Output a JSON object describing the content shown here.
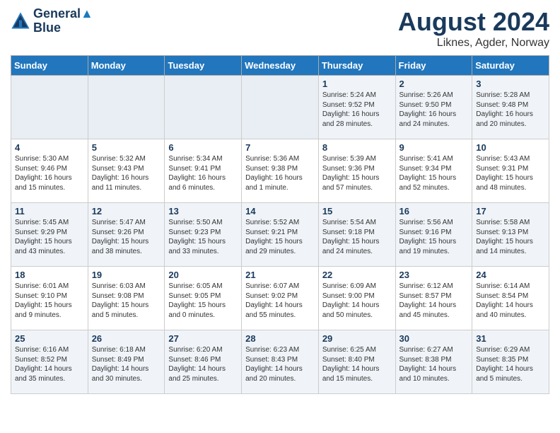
{
  "logo": {
    "line1": "General",
    "line2": "Blue"
  },
  "title": "August 2024",
  "subtitle": "Liknes, Agder, Norway",
  "header_days": [
    "Sunday",
    "Monday",
    "Tuesday",
    "Wednesday",
    "Thursday",
    "Friday",
    "Saturday"
  ],
  "weeks": [
    [
      {
        "day": "",
        "info": ""
      },
      {
        "day": "",
        "info": ""
      },
      {
        "day": "",
        "info": ""
      },
      {
        "day": "",
        "info": ""
      },
      {
        "day": "1",
        "info": "Sunrise: 5:24 AM\nSunset: 9:52 PM\nDaylight: 16 hours\nand 28 minutes."
      },
      {
        "day": "2",
        "info": "Sunrise: 5:26 AM\nSunset: 9:50 PM\nDaylight: 16 hours\nand 24 minutes."
      },
      {
        "day": "3",
        "info": "Sunrise: 5:28 AM\nSunset: 9:48 PM\nDaylight: 16 hours\nand 20 minutes."
      }
    ],
    [
      {
        "day": "4",
        "info": "Sunrise: 5:30 AM\nSunset: 9:46 PM\nDaylight: 16 hours\nand 15 minutes."
      },
      {
        "day": "5",
        "info": "Sunrise: 5:32 AM\nSunset: 9:43 PM\nDaylight: 16 hours\nand 11 minutes."
      },
      {
        "day": "6",
        "info": "Sunrise: 5:34 AM\nSunset: 9:41 PM\nDaylight: 16 hours\nand 6 minutes."
      },
      {
        "day": "7",
        "info": "Sunrise: 5:36 AM\nSunset: 9:38 PM\nDaylight: 16 hours\nand 1 minute."
      },
      {
        "day": "8",
        "info": "Sunrise: 5:39 AM\nSunset: 9:36 PM\nDaylight: 15 hours\nand 57 minutes."
      },
      {
        "day": "9",
        "info": "Sunrise: 5:41 AM\nSunset: 9:34 PM\nDaylight: 15 hours\nand 52 minutes."
      },
      {
        "day": "10",
        "info": "Sunrise: 5:43 AM\nSunset: 9:31 PM\nDaylight: 15 hours\nand 48 minutes."
      }
    ],
    [
      {
        "day": "11",
        "info": "Sunrise: 5:45 AM\nSunset: 9:29 PM\nDaylight: 15 hours\nand 43 minutes."
      },
      {
        "day": "12",
        "info": "Sunrise: 5:47 AM\nSunset: 9:26 PM\nDaylight: 15 hours\nand 38 minutes."
      },
      {
        "day": "13",
        "info": "Sunrise: 5:50 AM\nSunset: 9:23 PM\nDaylight: 15 hours\nand 33 minutes."
      },
      {
        "day": "14",
        "info": "Sunrise: 5:52 AM\nSunset: 9:21 PM\nDaylight: 15 hours\nand 29 minutes."
      },
      {
        "day": "15",
        "info": "Sunrise: 5:54 AM\nSunset: 9:18 PM\nDaylight: 15 hours\nand 24 minutes."
      },
      {
        "day": "16",
        "info": "Sunrise: 5:56 AM\nSunset: 9:16 PM\nDaylight: 15 hours\nand 19 minutes."
      },
      {
        "day": "17",
        "info": "Sunrise: 5:58 AM\nSunset: 9:13 PM\nDaylight: 15 hours\nand 14 minutes."
      }
    ],
    [
      {
        "day": "18",
        "info": "Sunrise: 6:01 AM\nSunset: 9:10 PM\nDaylight: 15 hours\nand 9 minutes."
      },
      {
        "day": "19",
        "info": "Sunrise: 6:03 AM\nSunset: 9:08 PM\nDaylight: 15 hours\nand 5 minutes."
      },
      {
        "day": "20",
        "info": "Sunrise: 6:05 AM\nSunset: 9:05 PM\nDaylight: 15 hours\nand 0 minutes."
      },
      {
        "day": "21",
        "info": "Sunrise: 6:07 AM\nSunset: 9:02 PM\nDaylight: 14 hours\nand 55 minutes."
      },
      {
        "day": "22",
        "info": "Sunrise: 6:09 AM\nSunset: 9:00 PM\nDaylight: 14 hours\nand 50 minutes."
      },
      {
        "day": "23",
        "info": "Sunrise: 6:12 AM\nSunset: 8:57 PM\nDaylight: 14 hours\nand 45 minutes."
      },
      {
        "day": "24",
        "info": "Sunrise: 6:14 AM\nSunset: 8:54 PM\nDaylight: 14 hours\nand 40 minutes."
      }
    ],
    [
      {
        "day": "25",
        "info": "Sunrise: 6:16 AM\nSunset: 8:52 PM\nDaylight: 14 hours\nand 35 minutes."
      },
      {
        "day": "26",
        "info": "Sunrise: 6:18 AM\nSunset: 8:49 PM\nDaylight: 14 hours\nand 30 minutes."
      },
      {
        "day": "27",
        "info": "Sunrise: 6:20 AM\nSunset: 8:46 PM\nDaylight: 14 hours\nand 25 minutes."
      },
      {
        "day": "28",
        "info": "Sunrise: 6:23 AM\nSunset: 8:43 PM\nDaylight: 14 hours\nand 20 minutes."
      },
      {
        "day": "29",
        "info": "Sunrise: 6:25 AM\nSunset: 8:40 PM\nDaylight: 14 hours\nand 15 minutes."
      },
      {
        "day": "30",
        "info": "Sunrise: 6:27 AM\nSunset: 8:38 PM\nDaylight: 14 hours\nand 10 minutes."
      },
      {
        "day": "31",
        "info": "Sunrise: 6:29 AM\nSunset: 8:35 PM\nDaylight: 14 hours\nand 5 minutes."
      }
    ]
  ]
}
